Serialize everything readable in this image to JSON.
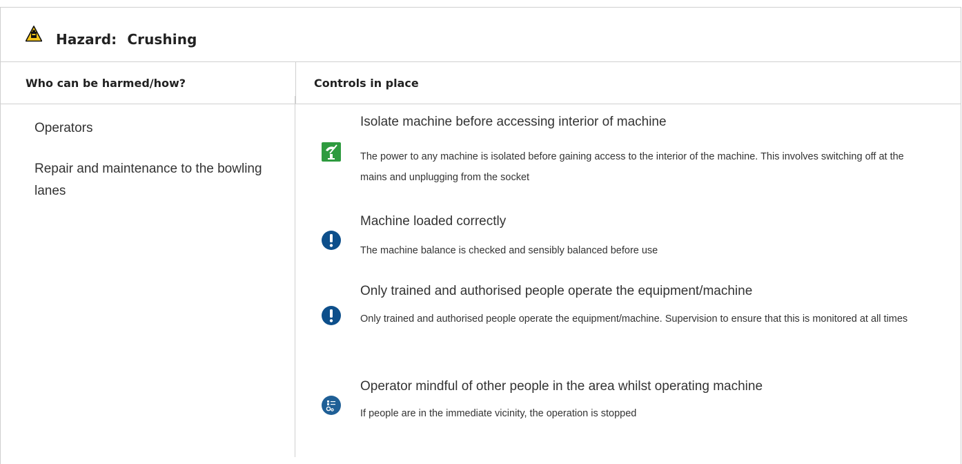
{
  "hazard": {
    "label": "Hazard:",
    "name": "Crushing",
    "icon": "crushing-warning-icon"
  },
  "columns": {
    "who": "Who can be harmed/how?",
    "controls": "Controls in place"
  },
  "who_items": [
    "Operators",
    "Repair and maintenance to the bowling lanes"
  ],
  "controls": [
    {
      "icon": "isolate-power-icon",
      "title": "Isolate machine before accessing interior of machine",
      "description": "The power to any machine is isolated before gaining access to the interior of the machine. This involves switching off at the mains and unplugging from the socket"
    },
    {
      "icon": "exclamation-icon",
      "title": "Machine loaded correctly",
      "description": "The machine balance is checked and sensibly balanced before use"
    },
    {
      "icon": "exclamation-icon",
      "title": "Only trained and authorised people operate the equipment/machine",
      "description": "Only trained and authorised people operate the equipment/machine. Supervision to ensure that this is monitored at all times"
    },
    {
      "icon": "procedure-gears-icon",
      "title": "Operator mindful of other people in the area whilst operating machine",
      "description": "If people are in the immediate vicinity, the operation is stopped"
    }
  ],
  "colors": {
    "warning_yellow": "#f5c518",
    "safety_green": "#2e9b3f",
    "mandatory_blue": "#0d4f8b",
    "border": "#cfcfcf"
  }
}
